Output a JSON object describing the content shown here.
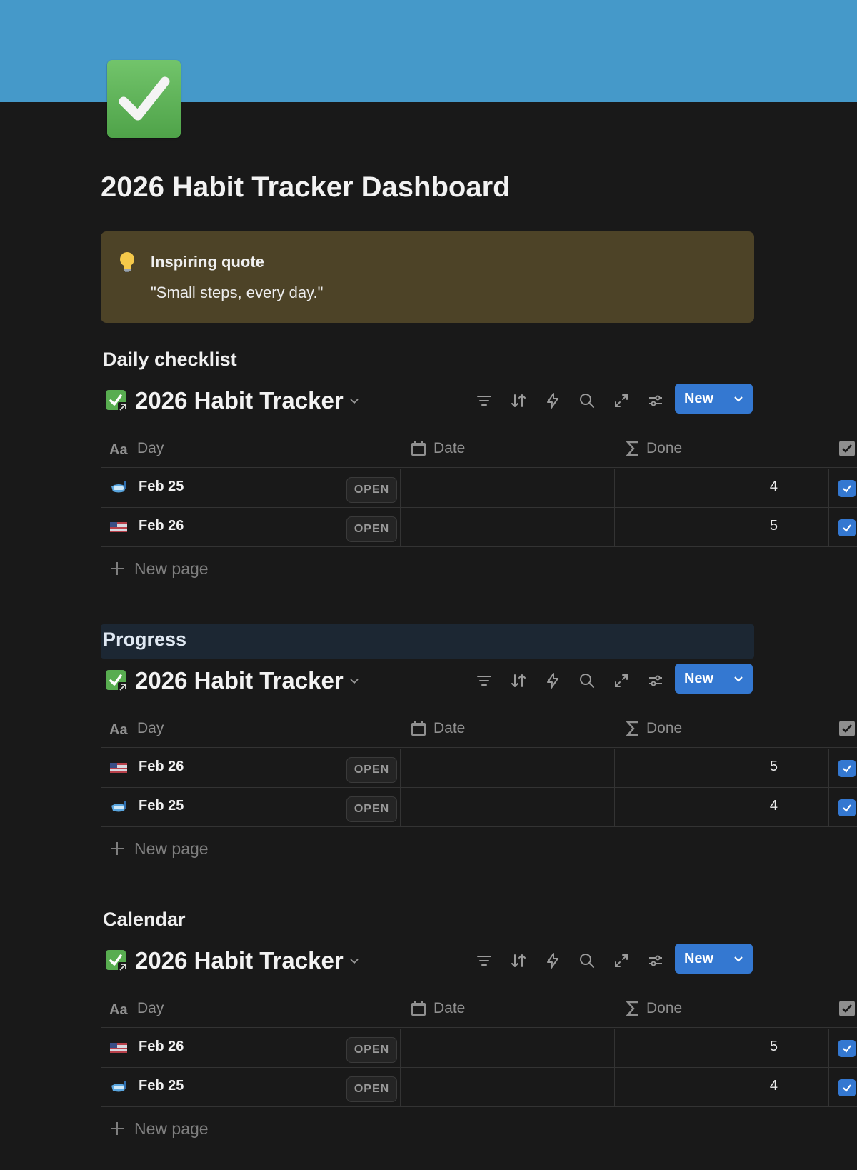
{
  "page": {
    "title": "2026 Habit Tracker Dashboard",
    "cover_color": "#4599c9",
    "icon": "check-mark-button-emoji"
  },
  "callout": {
    "icon": "light-bulb-icon",
    "title": "Inspiring quote",
    "text": "\"Small steps, every day.\"",
    "background": "#4d4327"
  },
  "accent_color": "#3478d1",
  "sections": [
    {
      "heading": "Daily checklist",
      "database": {
        "title": "2026 Habit Tracker",
        "new_label": "New",
        "columns": [
          "Day",
          "Date",
          "Done"
        ],
        "rows": [
          {
            "day": "Feb 25",
            "open": "OPEN",
            "done": "4",
            "checked": true,
            "emoji": "diving-mask"
          },
          {
            "day": "Feb 26",
            "open": "OPEN",
            "done": "5",
            "checked": true,
            "emoji": "flag-image"
          }
        ],
        "new_page_label": "New page"
      }
    },
    {
      "heading": "Progress",
      "database": {
        "title": "2026 Habit Tracker",
        "new_label": "New",
        "columns": [
          "Day",
          "Date",
          "Done"
        ],
        "rows": [
          {
            "day": "Feb 26",
            "open": "OPEN",
            "done": "5",
            "checked": true,
            "emoji": "flag-image"
          },
          {
            "day": "Feb 25",
            "open": "OPEN",
            "done": "4",
            "checked": true,
            "emoji": "diving-mask"
          }
        ],
        "new_page_label": "New page"
      }
    },
    {
      "heading": "Calendar",
      "database": {
        "title": "2026 Habit Tracker",
        "new_label": "New",
        "columns": [
          "Day",
          "Date",
          "Done"
        ],
        "rows": [
          {
            "day": "Feb 26",
            "open": "OPEN",
            "done": "5",
            "checked": true,
            "emoji": "flag-image"
          },
          {
            "day": "Feb 25",
            "open": "OPEN",
            "done": "4",
            "checked": true,
            "emoji": "diving-mask"
          }
        ],
        "new_page_label": "New page"
      }
    }
  ]
}
